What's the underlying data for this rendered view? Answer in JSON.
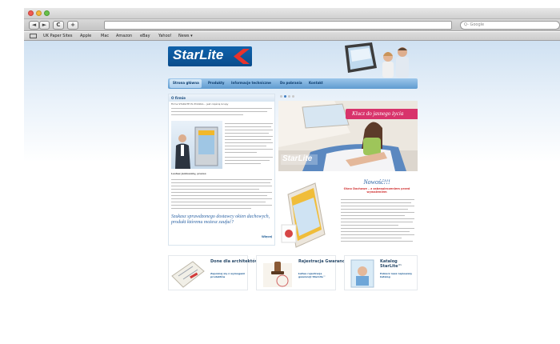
{
  "browser": {
    "search_placeholder": "Q- Google",
    "nav_back": "◄",
    "nav_forward": "►",
    "reload": "C",
    "add": "+",
    "bookmarks": [
      "UK Paper Sites",
      "Apple",
      "Mac",
      "Amazon",
      "eBay",
      "Yahoo!",
      "News ▾"
    ]
  },
  "site": {
    "logo": "StarLite",
    "nav": [
      "Strona główna",
      "Produkty",
      "Informacje techniczne",
      "Do pobrania",
      "Kontakt"
    ],
    "left_panel": {
      "header": "O firmie",
      "intro": "Firma STARLITE PL POLSKA... jest częścią Grupy",
      "caption": "Lesław Jankowsky, prezes",
      "quote": "Szukasz sprawdzonego dostawcy okien dachowych, produkt któremu możesz zaufać?",
      "more": "Więcej"
    },
    "hero": {
      "ribbon": "Klucz do jasnego życia",
      "watermark": "StarLite"
    },
    "news": {
      "title": "Nowość!!!",
      "subtitle": "Okno Dachowe – z zabezpieczeniem przed wyważeniem"
    },
    "cards": [
      {
        "title": "Done dla architektów",
        "sub": "Zapoznaj się z wymogami produktów"
      },
      {
        "title": "Rejestracja Gwarancji",
        "sub": "Łatwa rejestracja gwarancji StarLite™"
      },
      {
        "title": "Katalog StarLite™",
        "sub": "Pobierz nasz najnowszy katalog"
      }
    ]
  },
  "colors": {
    "brand_blue": "#0f62ab",
    "ribbon_pink": "#d8336b",
    "nav_blue": "#5f9bd0"
  }
}
